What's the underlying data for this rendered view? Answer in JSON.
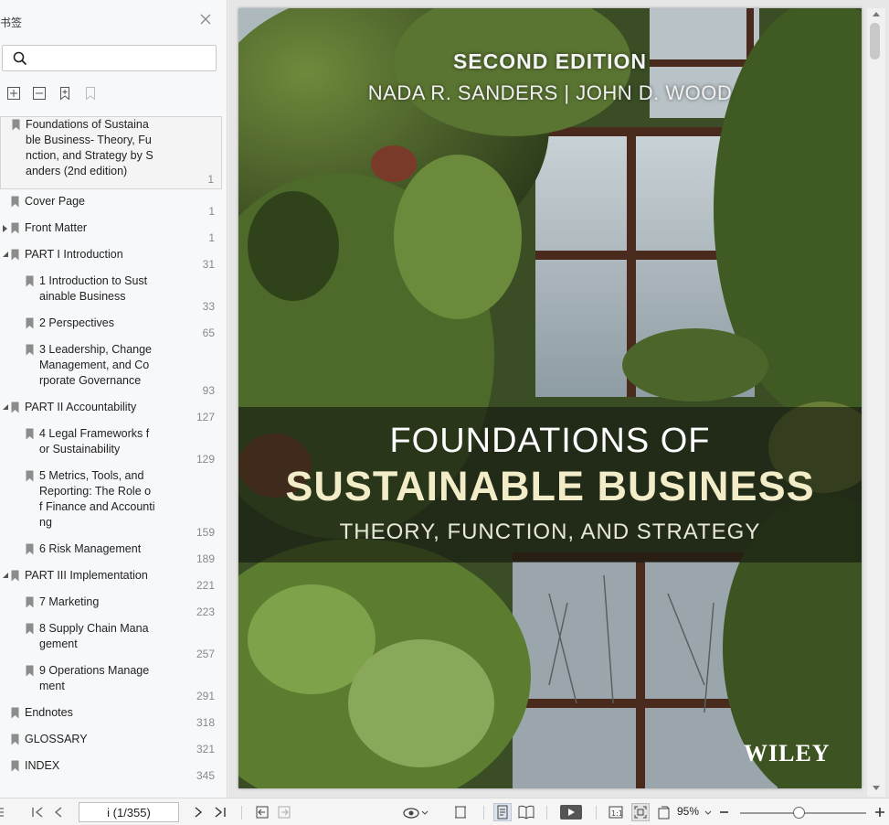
{
  "sidebar": {
    "title": "书签",
    "search": {
      "value": "",
      "placeholder": ""
    },
    "tools": [
      "expand-all-icon",
      "collapse-all-icon",
      "add-bookmark-icon",
      "delete-bookmark-icon"
    ],
    "bookmarks": [
      {
        "text": "Foundations of Sustaina\nble Business- Theory, Fu\nnction, and Strategy by S\nanders (2nd edition)",
        "page": "1",
        "level": 0,
        "toggle": "none",
        "selected": true
      },
      {
        "text": "Cover Page",
        "page": "1",
        "level": 0,
        "toggle": "none"
      },
      {
        "text": "Front Matter",
        "page": "1",
        "level": 0,
        "toggle": "collapsed"
      },
      {
        "text": "PART I Introduction",
        "page": "31",
        "level": 0,
        "toggle": "expanded"
      },
      {
        "text": "1 Introduction to Sust\nainable Business",
        "page": "33",
        "level": 1,
        "toggle": "none"
      },
      {
        "text": "2 Perspectives",
        "page": "65",
        "level": 1,
        "toggle": "none"
      },
      {
        "text": "3 Leadership, Change\nManagement, and Co\nrporate Governance",
        "page": "93",
        "level": 1,
        "toggle": "none"
      },
      {
        "text": "PART II Accountability",
        "page": "127",
        "level": 0,
        "toggle": "expanded"
      },
      {
        "text": "4 Legal Frameworks f\nor Sustainability",
        "page": "129",
        "level": 1,
        "toggle": "none"
      },
      {
        "text": "5 Metrics, Tools, and\nReporting: The Role o\nf Finance and Accounti\nng",
        "page": "159",
        "level": 1,
        "toggle": "none"
      },
      {
        "text": "6 Risk Management",
        "page": "189",
        "level": 1,
        "toggle": "none"
      },
      {
        "text": "PART III Implementation",
        "page": "221",
        "level": 0,
        "toggle": "expanded"
      },
      {
        "text": "7 Marketing",
        "page": "223",
        "level": 1,
        "toggle": "none"
      },
      {
        "text": "8 Supply Chain Mana\ngement",
        "page": "257",
        "level": 1,
        "toggle": "none"
      },
      {
        "text": "9 Operations Manage\nment",
        "page": "291",
        "level": 1,
        "toggle": "none"
      },
      {
        "text": "Endnotes",
        "page": "318",
        "level": 0,
        "toggle": "none"
      },
      {
        "text": "GLOSSARY",
        "page": "321",
        "level": 0,
        "toggle": "none"
      },
      {
        "text": "INDEX",
        "page": "345",
        "level": 0,
        "toggle": "none"
      }
    ]
  },
  "cover": {
    "edition": "SECOND EDITION",
    "authors": "NADA R. SANDERS | JOHN D. WOOD",
    "title_line1": "FOUNDATIONS OF",
    "title_line2": "SUSTAINABLE BUSINESS",
    "subtitle": "THEORY, FUNCTION, AND STRATEGY",
    "publisher": "WILEY"
  },
  "toolbar": {
    "page_indicator": "i (1/355)",
    "zoom": "95%"
  },
  "colors": {
    "accent": "#3c7abf",
    "sidebar_bg": "#f7f8fa",
    "view_bg": "#e6e6e6"
  }
}
